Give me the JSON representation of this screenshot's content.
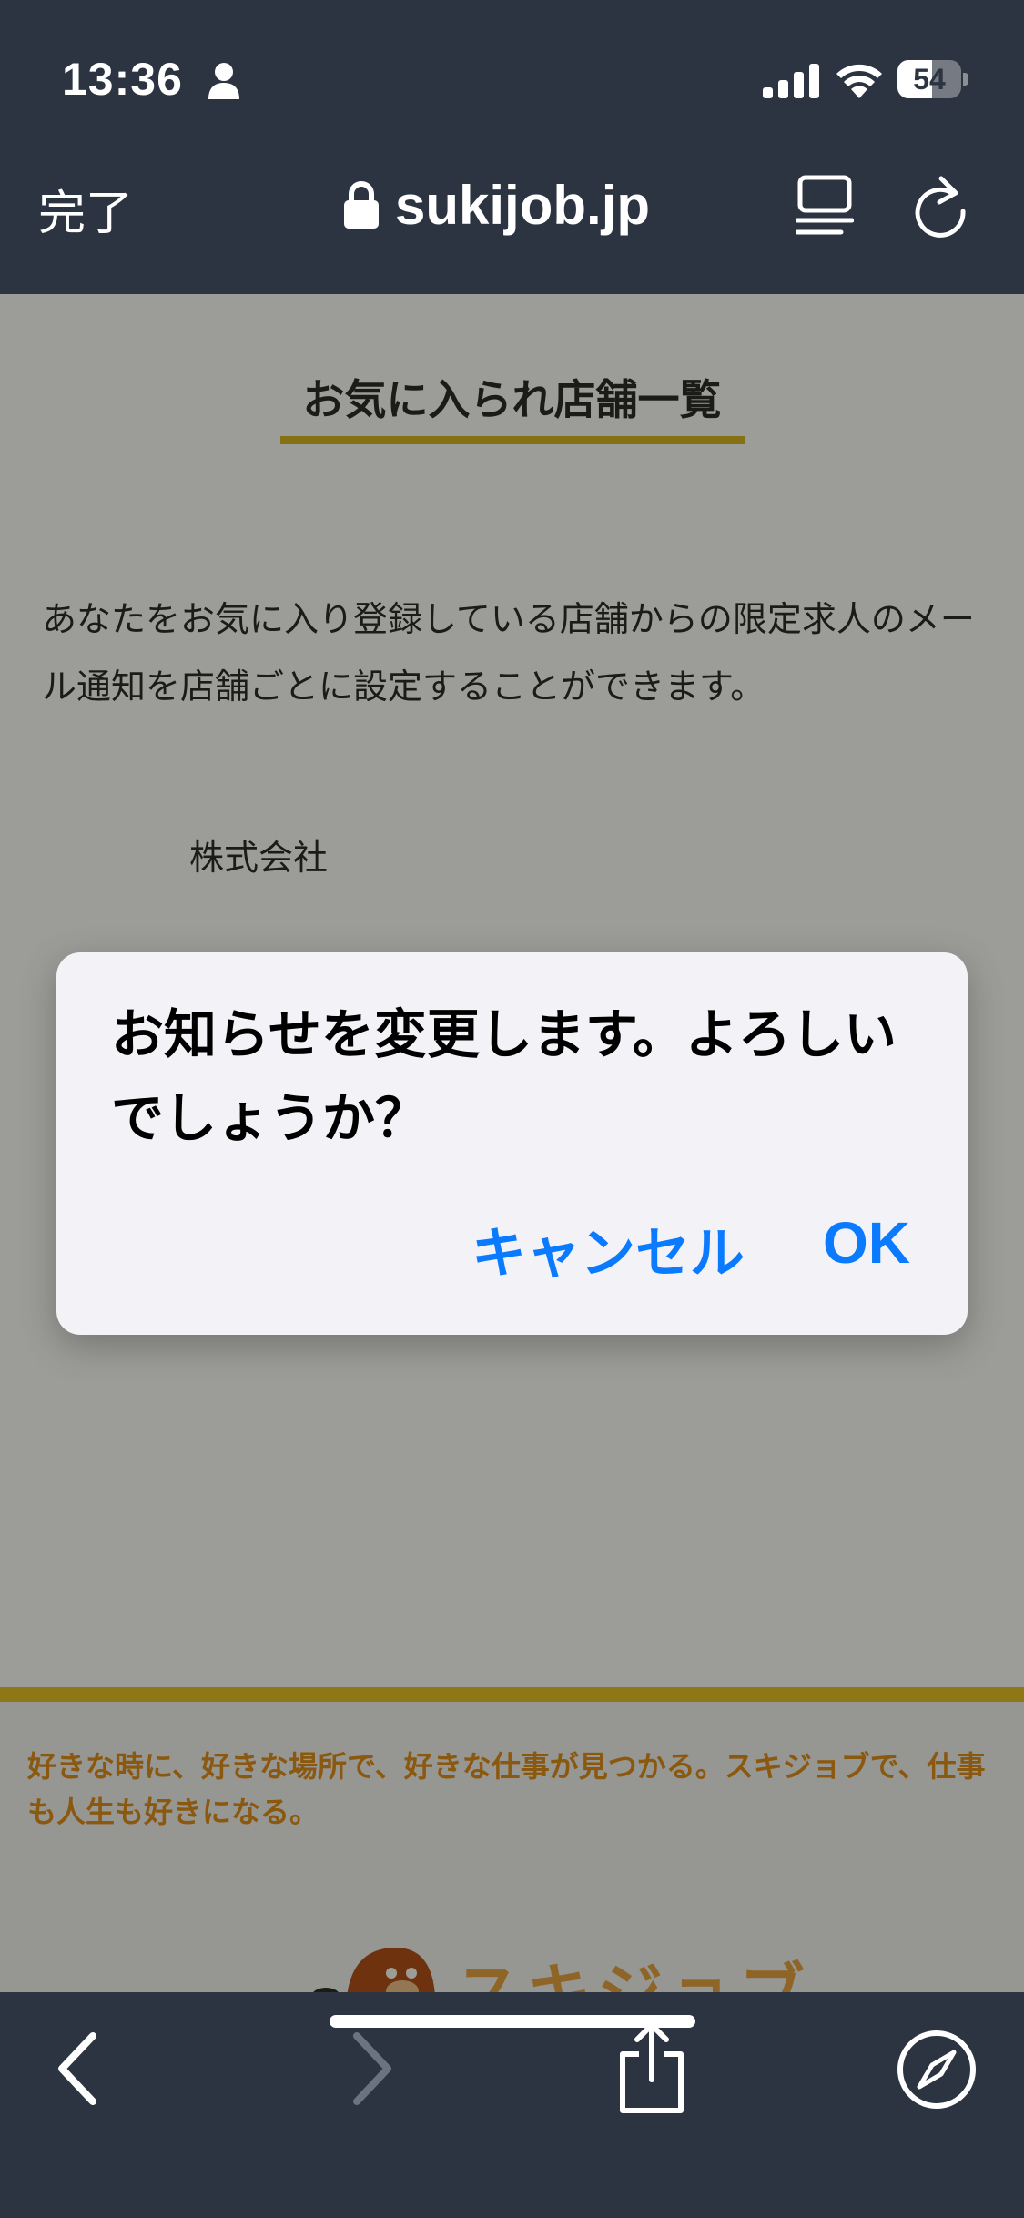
{
  "status_bar": {
    "time": "13:36",
    "battery": "54",
    "battery_level": 0.54
  },
  "safari": {
    "done_label": "完了",
    "url": "sukijob.jp"
  },
  "page": {
    "title": "お気に入られ店舗一覧",
    "intro": "あなたをお気に入り登録している店舗からの限定求人のメール通知を店舗ごとに設定することができます。",
    "company": "株式会社",
    "tagline": "好きな時に、好きな場所で、好きな仕事が見つかる。スキジョブで、仕事も人生も好きになる。",
    "logo_text": "スキジョブ"
  },
  "alert": {
    "message": "お知らせを変更します。よろしいでしょうか？",
    "cancel_label": "キャンセル",
    "ok_label": "OK"
  },
  "colors": {
    "accent": "#0a7aff",
    "chrome": "#2c3441",
    "brand_yellow": "#d8b41c",
    "brand_orange": "#e08a12"
  },
  "icons": [
    "person-icon",
    "signal-icon",
    "wifi-icon",
    "lock-icon",
    "reader-icon",
    "reload-icon",
    "back-icon",
    "forward-icon",
    "share-icon",
    "compass-icon"
  ]
}
